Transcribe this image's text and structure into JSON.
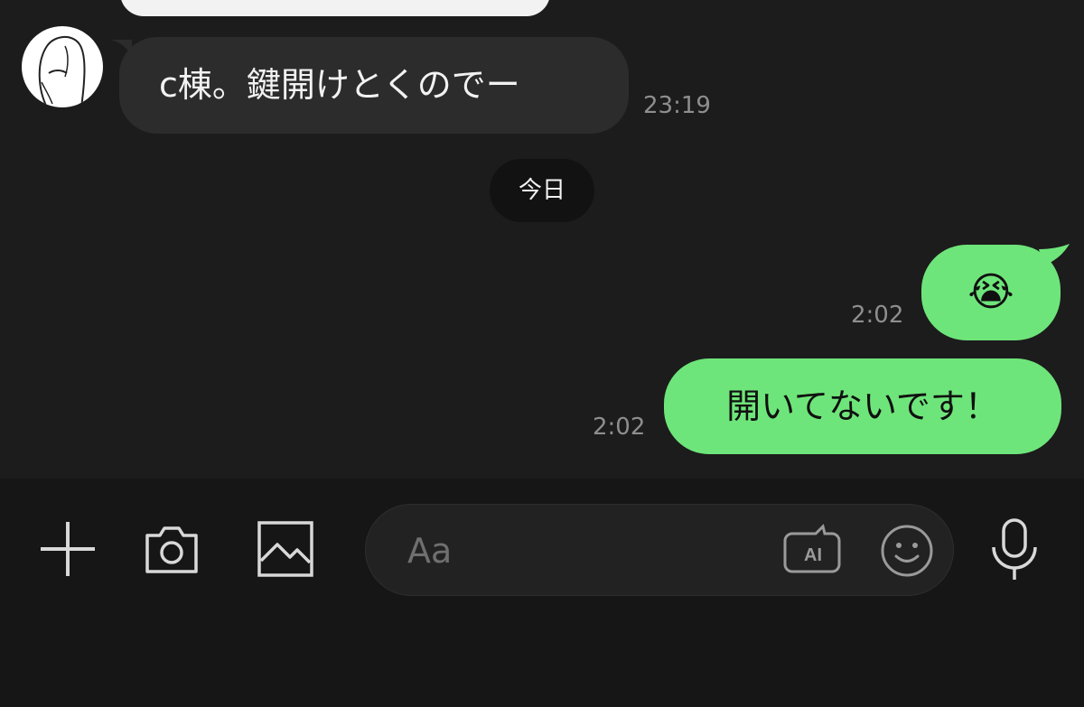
{
  "chat": {
    "incoming": {
      "text": "c棟。鍵開けとくのでー",
      "time": "23:19"
    },
    "date_separator": "今日",
    "outgoing": [
      {
        "text": "😭",
        "time": "2:02"
      },
      {
        "text": "開いてないです！",
        "time": "2:02"
      }
    ]
  },
  "composer": {
    "placeholder": "Aa",
    "ai_label": "AI",
    "icons": [
      "plus-icon",
      "camera-icon",
      "image-icon",
      "ai-icon",
      "emoji-icon",
      "microphone-icon"
    ]
  },
  "colors": {
    "background": "#1c1c1c",
    "incoming_bubble": "#2c2c2c",
    "outgoing_bubble": "#6ee57a",
    "timestamp": "#8e8e8e"
  }
}
